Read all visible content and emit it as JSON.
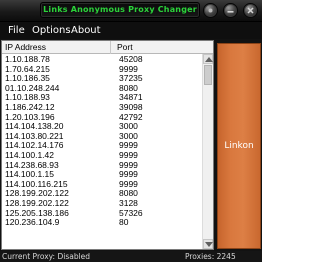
{
  "window": {
    "title": "Links Anonymous Proxy Changer"
  },
  "menu": {
    "file": "File",
    "options": "Options",
    "about": "About"
  },
  "proxy_list": {
    "columns": {
      "ip": "IP Address",
      "port": "Port"
    },
    "rows": [
      {
        "ip": "1.10.188.78",
        "port": "45208"
      },
      {
        "ip": "1.70.64.215",
        "port": "9999"
      },
      {
        "ip": "1.10.186.35",
        "port": "37235"
      },
      {
        "ip": "01.10.248.244",
        "port": "8080"
      },
      {
        "ip": "1.10.188.93",
        "port": "34871"
      },
      {
        "ip": "1.186.242.12",
        "port": "39098"
      },
      {
        "ip": "1.20.103.196",
        "port": "42792"
      },
      {
        "ip": "114.104.138.20",
        "port": "3000"
      },
      {
        "ip": "114.103.80.221",
        "port": "3000"
      },
      {
        "ip": "114.102.14.176",
        "port": "9999"
      },
      {
        "ip": "114.100.1.42",
        "port": "9999"
      },
      {
        "ip": "114.238.68.93",
        "port": "9999"
      },
      {
        "ip": "114.100.1.15",
        "port": "9999"
      },
      {
        "ip": "114.100.116.215",
        "port": "9999"
      },
      {
        "ip": "128.199.202.122",
        "port": "8080"
      },
      {
        "ip": "128.199.202.122",
        "port": "3128"
      },
      {
        "ip": "125.205.138.186",
        "port": "57326"
      },
      {
        "ip": "120.236.104.9",
        "port": "80"
      }
    ]
  },
  "link_button": {
    "label": "Linkon"
  },
  "status": {
    "current_proxy": "Current Proxy: Disabled",
    "proxies_count": "Proxies: 2245"
  },
  "colors": {
    "title_text": "#2bd33a",
    "link_button": "#d9783e",
    "frame": "#121212"
  },
  "icons": {
    "title_buttons": [
      "help-icon",
      "minimize-icon",
      "close-icon"
    ],
    "scroll": [
      "scroll-up-icon",
      "scroll-down-icon"
    ]
  }
}
